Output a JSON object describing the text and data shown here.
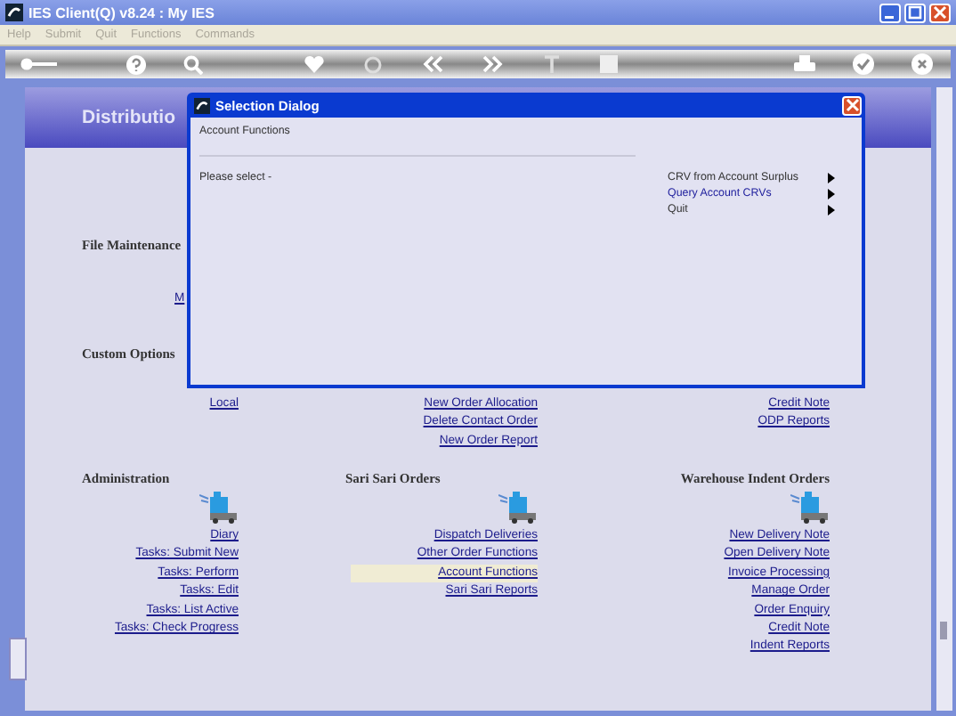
{
  "window": {
    "title": "IES Client(Q) v8.24 : My IES"
  },
  "menu": [
    {
      "label": "Help",
      "disabled": true
    },
    {
      "label": "Submit",
      "disabled": true
    },
    {
      "label": "Quit",
      "disabled": true
    },
    {
      "label": "Functions",
      "disabled": true
    },
    {
      "label": "Commands",
      "disabled": true
    }
  ],
  "header": {
    "title": "Distributio"
  },
  "file_maintenance": {
    "heading": "File Maintenance",
    "links": [
      "M"
    ]
  },
  "custom_options": {
    "heading": "Custom Options"
  },
  "upper_links": [
    [
      "Local"
    ],
    [
      "New Order Allocation",
      "Delete Contact Order",
      "New Order Report"
    ],
    [
      "Credit Note",
      "ODP Reports"
    ]
  ],
  "sections": [
    {
      "heading": "Administration",
      "links": [
        {
          "label": "Diary",
          "selected": false
        },
        {
          "label": "Tasks: Submit New",
          "selected": false
        },
        {
          "label": "Tasks: Perform",
          "selected": false
        },
        {
          "label": "Tasks: Edit",
          "selected": false
        },
        {
          "label": "Tasks: List Active",
          "selected": false
        },
        {
          "label": "Tasks: Check Progress",
          "selected": false
        }
      ]
    },
    {
      "heading": "Sari Sari Orders",
      "links": [
        {
          "label": "Dispatch Deliveries",
          "selected": false
        },
        {
          "label": "Other Order Functions",
          "selected": false
        },
        {
          "label": "Account Functions",
          "selected": true
        },
        {
          "label": "Sari Sari Reports",
          "selected": false
        }
      ]
    },
    {
      "heading": "Warehouse Indent Orders",
      "links": [
        {
          "label": "New Delivery Note",
          "selected": false
        },
        {
          "label": "Open Delivery Note",
          "selected": false
        },
        {
          "label": "Invoice Processing",
          "selected": false
        },
        {
          "label": "Manage Order",
          "selected": false
        },
        {
          "label": "Order Enquiry",
          "selected": false
        },
        {
          "label": "Credit Note",
          "selected": false
        },
        {
          "label": "Indent Reports",
          "selected": false
        }
      ]
    }
  ],
  "dialog": {
    "title": "Selection Dialog",
    "subtitle": "Account Functions",
    "prompt": "Please select -",
    "options": [
      {
        "label": "CRV from Account Surplus",
        "selected": false
      },
      {
        "label": "Query Account CRVs",
        "selected": true
      },
      {
        "label": "Quit",
        "selected": false
      }
    ]
  }
}
